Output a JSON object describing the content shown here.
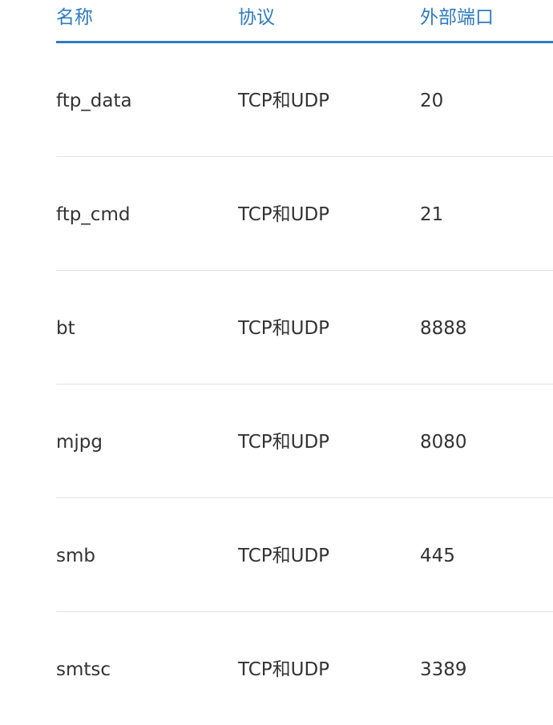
{
  "table": {
    "headers": {
      "name": "名称",
      "protocol": "协议",
      "external_port": "外部端口"
    },
    "rows": [
      {
        "name": "ftp_data",
        "protocol": "TCP和UDP",
        "port": "20"
      },
      {
        "name": "ftp_cmd",
        "protocol": "TCP和UDP",
        "port": "21"
      },
      {
        "name": "bt",
        "protocol": "TCP和UDP",
        "port": "8888"
      },
      {
        "name": "mjpg",
        "protocol": "TCP和UDP",
        "port": "8080"
      },
      {
        "name": "smb",
        "protocol": "TCP和UDP",
        "port": "445"
      },
      {
        "name": "smtsc",
        "protocol": "TCP和UDP",
        "port": "3389"
      }
    ]
  },
  "colors": {
    "header_text": "#2f7bc0",
    "header_rule": "#2f7bc0",
    "row_divider": "#e2e2e2",
    "body_text": "#333333"
  }
}
